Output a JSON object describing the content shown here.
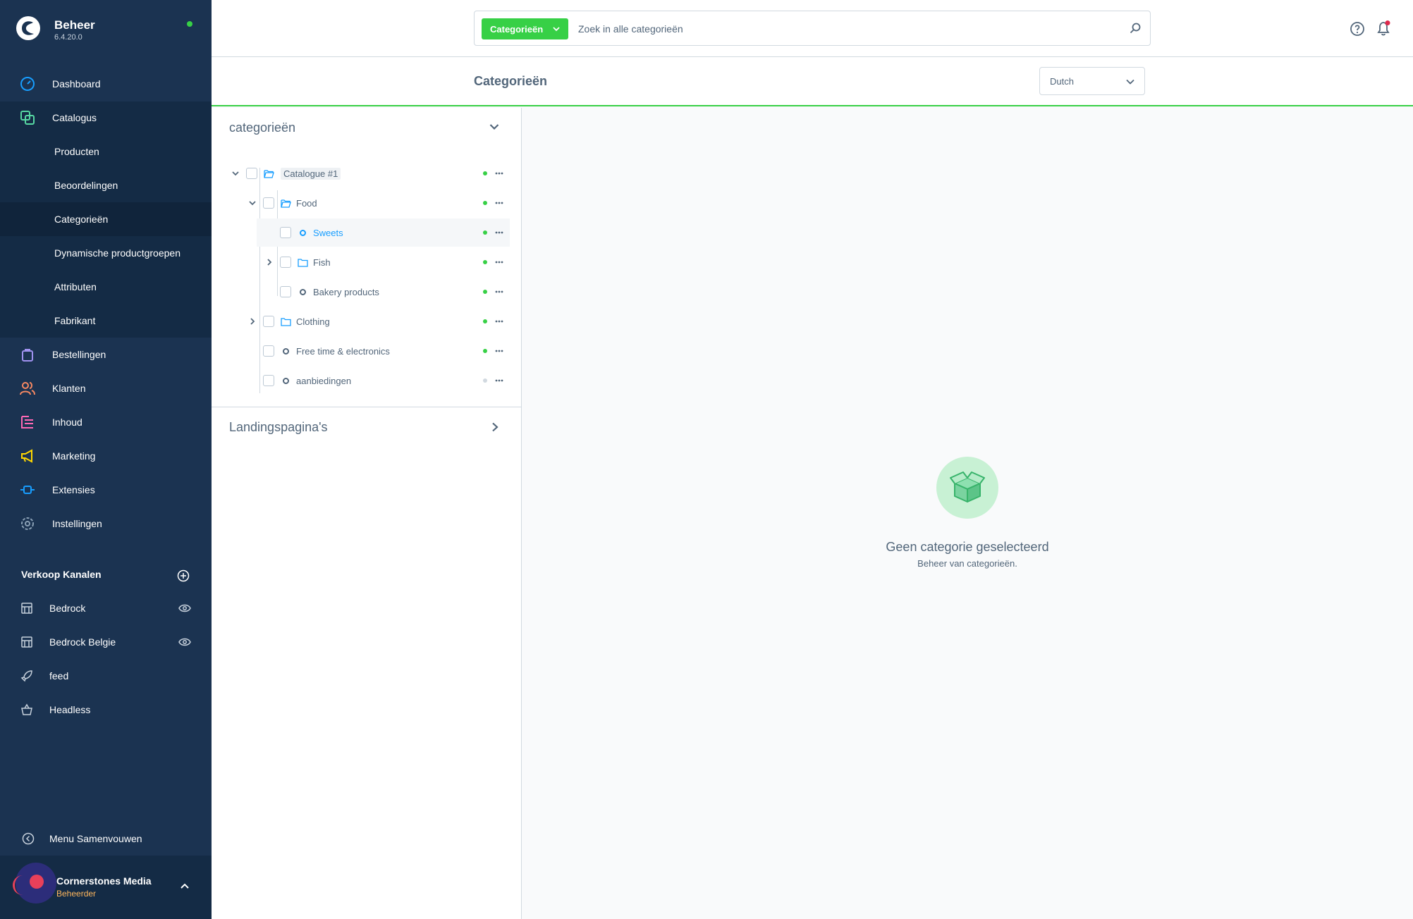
{
  "brand": {
    "title": "Beheer",
    "version": "6.4.20.0"
  },
  "nav": {
    "dashboard": "Dashboard",
    "catalog": "Catalogus",
    "catalog_sub": [
      "Producten",
      "Beoordelingen",
      "Categorieën",
      "Dynamische productgroepen",
      "Attributen",
      "Fabrikant"
    ],
    "orders": "Bestellingen",
    "customers": "Klanten",
    "content": "Inhoud",
    "marketing": "Marketing",
    "extensions": "Extensies",
    "settings": "Instellingen"
  },
  "channels": {
    "title": "Verkoop Kanalen",
    "items": [
      "Bedrock",
      "Bedrock Belgie",
      "feed",
      "Headless"
    ]
  },
  "collapse_label": "Menu Samenvouwen",
  "user": {
    "name": "Cornerstones Media",
    "role": "Beheerder"
  },
  "search": {
    "type_label": "Categorieën",
    "placeholder": "Zoek in alle categorieën"
  },
  "page": {
    "title": "Categorieën",
    "language": "Dutch"
  },
  "tree": {
    "header": "categorieën",
    "rows": [
      "Catalogue #1",
      "Food",
      "Sweets",
      "Fish",
      "Bakery products",
      "Clothing",
      "Free time & electronics",
      "aanbiedingen"
    ],
    "landing_header": "Landingspagina's"
  },
  "empty": {
    "title": "Geen categorie geselecteerd",
    "subtitle": "Beheer van categorieën."
  },
  "colors": {
    "sidebar": "#1b3351",
    "accent": "#37d046",
    "link": "#189eff",
    "text": "#52667a"
  }
}
